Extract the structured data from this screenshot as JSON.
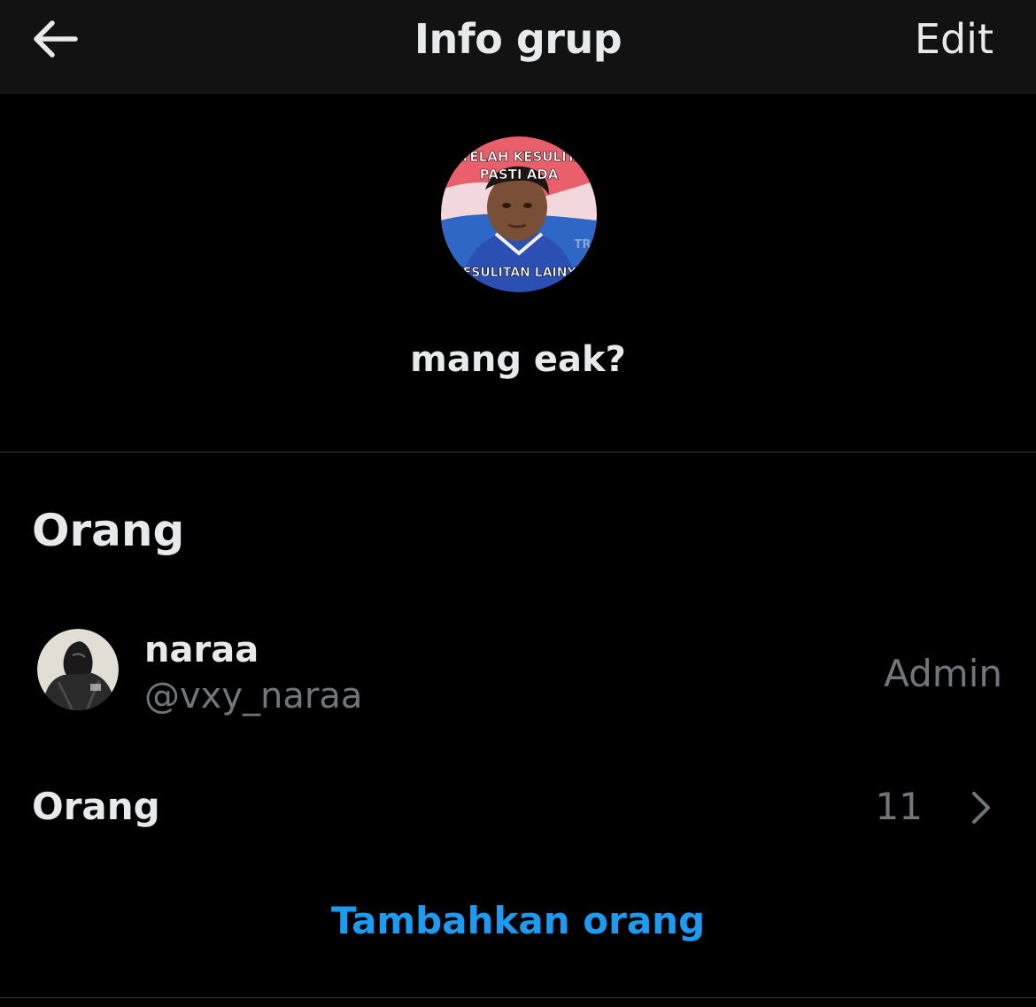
{
  "header": {
    "title": "Info grup",
    "edit_label": "Edit",
    "back_icon": "arrow-left-icon"
  },
  "group": {
    "name": "mang eak?",
    "avatar_caption_top_1": "SETELAH KESULITAN",
    "avatar_caption_top_2": "PASTI ADA",
    "avatar_caption_bottom": "KESULITAN LAINYA",
    "avatar_watermark": "TR"
  },
  "people_section": {
    "heading": "Orang",
    "members": [
      {
        "name": "naraa",
        "handle": "@vxy_naraa",
        "role": "Admin"
      }
    ],
    "people_row": {
      "label": "Orang",
      "count": "11",
      "chevron_icon": "chevron-right-icon"
    },
    "add_people_label": "Tambahkan orang"
  },
  "colors": {
    "background": "#000000",
    "header_bg": "#121212",
    "primary_text": "#e7e9ea",
    "secondary_text": "#71767b",
    "accent": "#1d9bf0",
    "divider": "#2f3336"
  }
}
